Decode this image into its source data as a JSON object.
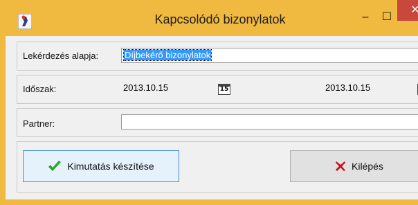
{
  "window": {
    "title": "Kapcsolódó bizonylatok",
    "minimize_glyph": "–",
    "maximize_glyph": "☐",
    "close_glyph": "✕"
  },
  "form": {
    "query_basis_label": "Lekérdezés alapja:",
    "query_basis_value": "Díjbekérő bizonylatok",
    "period_label": "Időszak:",
    "period_from": "2013.10.15",
    "period_to": "2013.10.15",
    "calendar_icon_text": "15",
    "partner_label": "Partner:",
    "partner_value": ""
  },
  "buttons": {
    "report_label": "Kimutatás készítése",
    "exit_label": "Kilépés"
  },
  "colors": {
    "titlebar": "#f0b93f",
    "close": "#c8483d",
    "selection": "#3399ff",
    "check": "#2fa32f",
    "cross": "#cc1111"
  }
}
